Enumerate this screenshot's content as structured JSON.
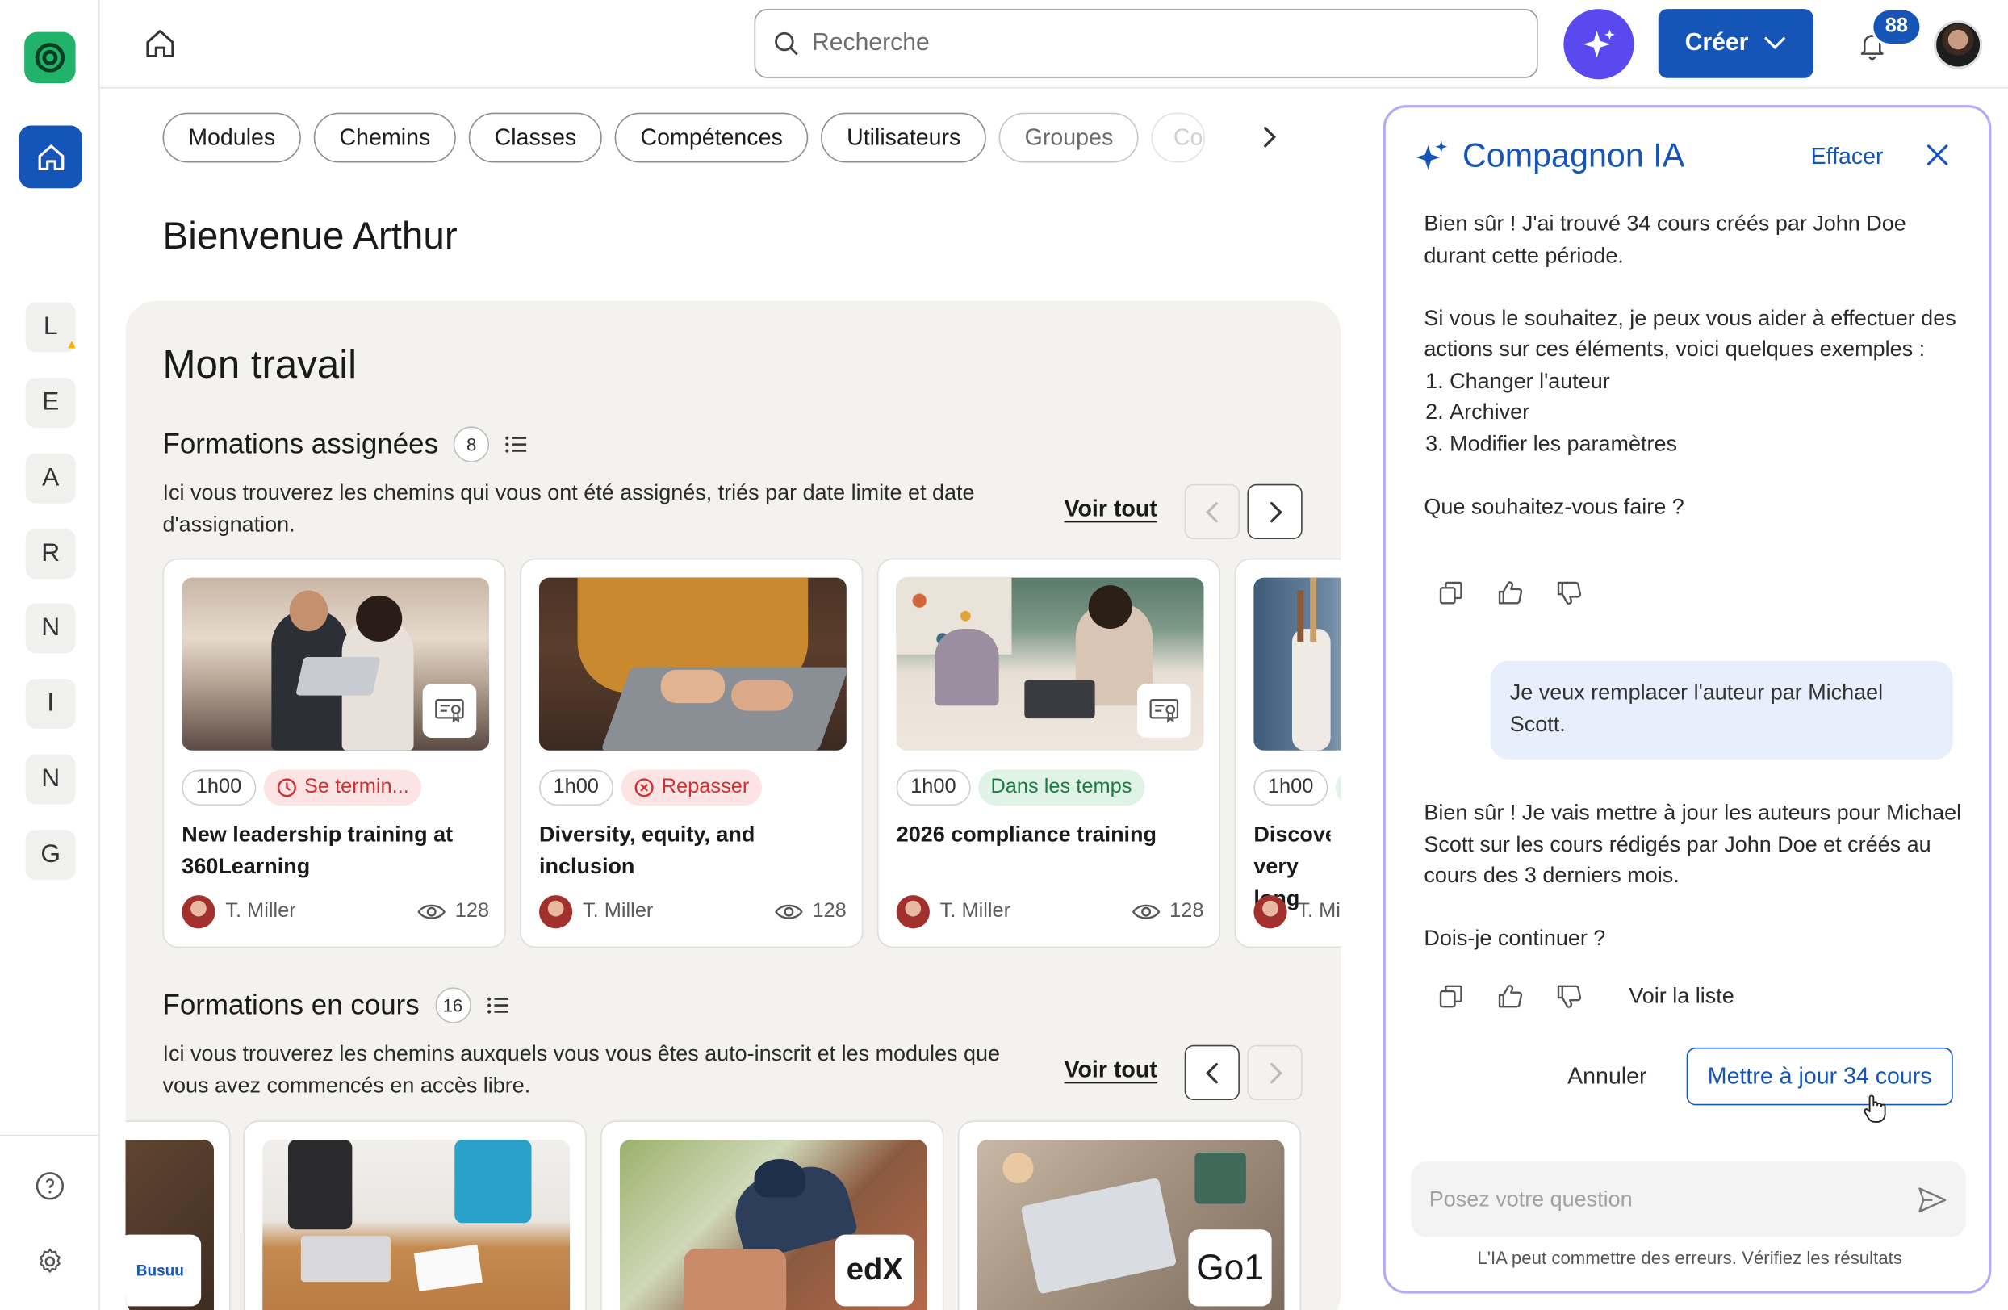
{
  "nav": {
    "workspaces": [
      "L",
      "E",
      "A",
      "R",
      "N",
      "I",
      "N",
      "G"
    ]
  },
  "topbar": {
    "search_placeholder": "Recherche",
    "create_label": "Créer",
    "notification_count": "88"
  },
  "filters": {
    "chips": [
      "Modules",
      "Chemins",
      "Classes",
      "Compétences",
      "Utilisateurs",
      "Groupes",
      "Co"
    ]
  },
  "home": {
    "welcome": "Bienvenue Arthur",
    "panel_title": "Mon travail"
  },
  "assigned": {
    "title": "Formations assignées",
    "count": "8",
    "description": "Ici vous trouverez les chemins qui vous ont été assignés, triés par date limite et date d'assignation.",
    "see_all": "Voir tout",
    "cards": [
      {
        "duration": "1h00",
        "status": "Se termin...",
        "status_kind": "red-clock",
        "title": "New leadership training at 360Learning",
        "author": "T. Miller",
        "views": "128",
        "certificate": true
      },
      {
        "duration": "1h00",
        "status": "Repasser",
        "status_kind": "red-x",
        "title": "Diversity, equity, and inclusion",
        "author": "T. Miller",
        "views": "128",
        "certificate": false
      },
      {
        "duration": "1h00",
        "status": "Dans les temps",
        "status_kind": "green",
        "title": "2026 compliance training",
        "author": "T. Miller",
        "views": "128",
        "certificate": true
      },
      {
        "duration": "1h00",
        "status": "",
        "status_kind": "green",
        "title": "Discover very long",
        "author": "T. Mi",
        "views": "",
        "certificate": false
      }
    ]
  },
  "in_progress": {
    "title": "Formations en cours",
    "count": "16",
    "description": "Ici vous trouverez les chemins auxquels vous vous êtes auto-inscrit et les modules que vous avez commencés en accès libre.",
    "see_all": "Voir tout",
    "providers": [
      "Busuu",
      "",
      "edX",
      "Go1"
    ]
  },
  "ai": {
    "title": "Compagnon IA",
    "clear": "Effacer",
    "msg1_line1": "Bien sûr ! J'ai trouvé 34 cours créés par John Doe durant cette période.",
    "msg1_line2": "Si vous le souhaitez, je peux vous aider à effectuer des actions sur ces éléments, voici quelques exemples :",
    "options": [
      "Changer l'auteur",
      "Archiver",
      "Modifier les paramètres"
    ],
    "msg1_question": "Que souhaitez-vous faire ?",
    "user_msg": "Je veux remplacer l'auteur par Michael Scott.",
    "msg2": "Bien sûr ! Je vais mettre à jour les auteurs pour Michael Scott sur les cours rédigés par John Doe et créés au cours des 3 derniers mois.",
    "msg2_question": "Dois-je continuer ?",
    "see_list": "Voir la liste",
    "cancel": "Annuler",
    "confirm": "Mettre à jour 34 cours",
    "input_placeholder": "Posez votre question",
    "disclaimer": "L'IA peut commettre des erreurs. Vérifiez les résultats"
  },
  "colors": {
    "brand_blue": "#1655b8",
    "ai_purple": "#5b49f0",
    "logo_green": "#22b36b",
    "status_red": "#d12f2f",
    "status_green": "#1c7a43"
  }
}
